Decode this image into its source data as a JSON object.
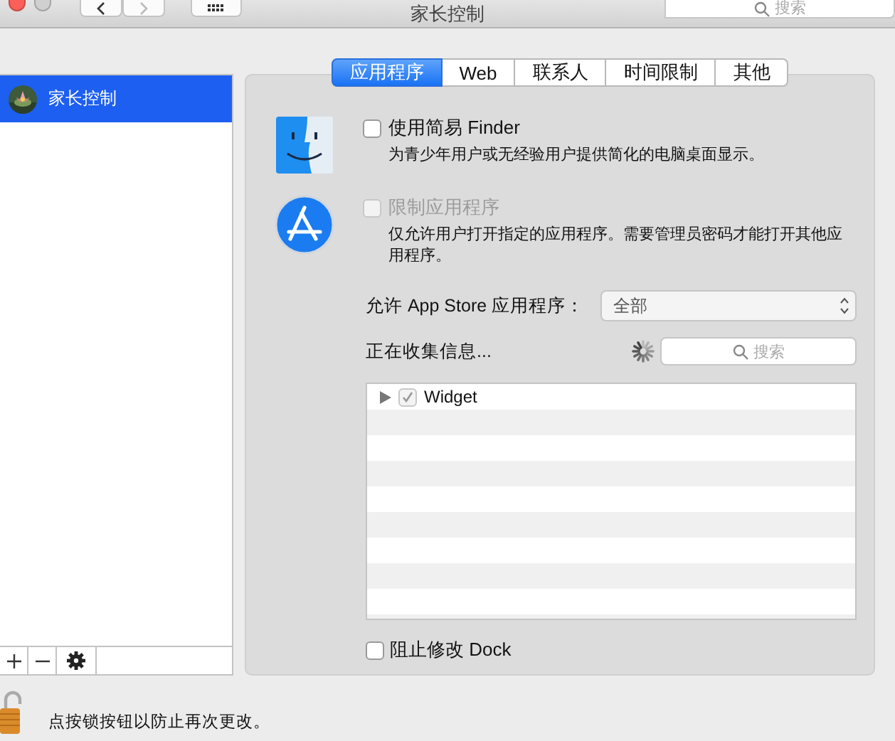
{
  "window": {
    "title": "家长控制",
    "search_placeholder": "搜索"
  },
  "sidebar": {
    "items": [
      {
        "label": "家长控制",
        "selected": true
      }
    ]
  },
  "tabs": [
    {
      "label": "应用程序",
      "selected": true
    },
    {
      "label": "Web",
      "selected": false
    },
    {
      "label": "联系人",
      "selected": false
    },
    {
      "label": "时间限制",
      "selected": false
    },
    {
      "label": "其他",
      "selected": false
    }
  ],
  "options": [
    {
      "kind": "finder",
      "label": "使用简易 Finder",
      "description": "为青少年用户或无经验用户提供简化的电脑桌面显示。",
      "checked": false,
      "disabled": false
    },
    {
      "kind": "appstore",
      "label": "限制应用程序",
      "description": "仅允许用户打开指定的应用程序。需要管理员密码才能打开其他应用程序。",
      "checked": false,
      "disabled": true
    }
  ],
  "app_store_limit": {
    "label": "允许 App Store 应用程序：",
    "value": "全部"
  },
  "status": "正在收集信息...",
  "app_search": {
    "placeholder": "搜索"
  },
  "apps": [
    {
      "name": "Widget",
      "checked": true,
      "expanded": false
    }
  ],
  "dock_option": {
    "label": "阻止修改 Dock",
    "checked": false
  },
  "lock_text": "点按锁按钮以防止再次更改。"
}
